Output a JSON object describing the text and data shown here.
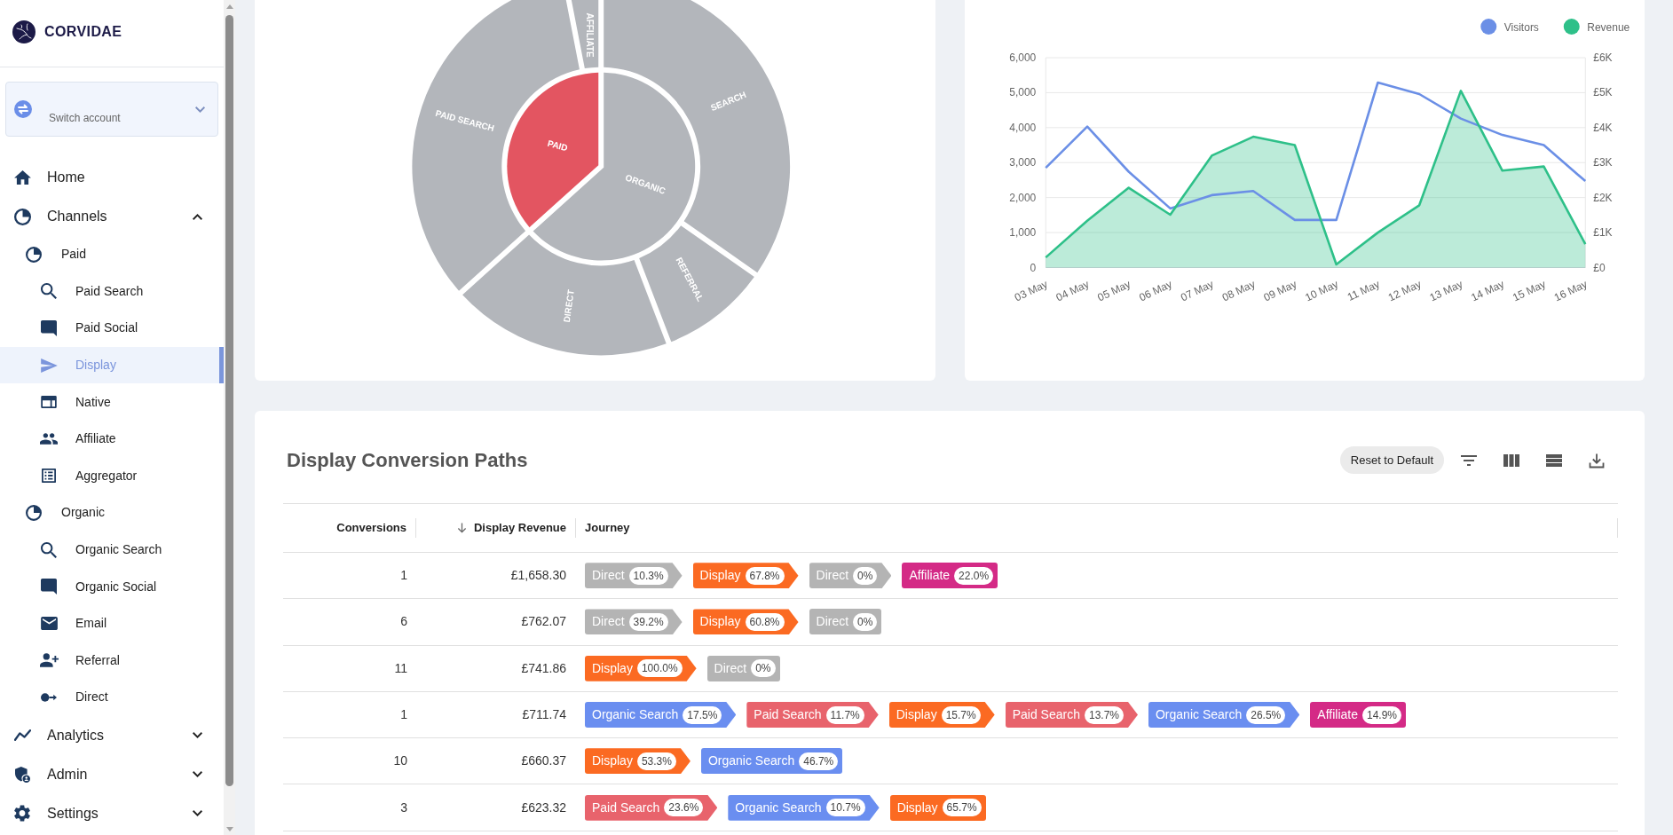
{
  "sidebar": {
    "brand": "CORVIDAE",
    "account": {
      "label": "Switch account",
      "expanded": false
    },
    "nav": [
      {
        "label": "Home",
        "selected": false
      },
      {
        "label": "Channels",
        "selected": false,
        "expanded": true,
        "children": [
          {
            "label": "Paid",
            "selected": false,
            "children": [
              {
                "label": "Paid Search",
                "selected": false
              },
              {
                "label": "Paid Social",
                "selected": false
              },
              {
                "label": "Display",
                "selected": true
              },
              {
                "label": "Native",
                "selected": false
              },
              {
                "label": "Affiliate",
                "selected": false
              },
              {
                "label": "Aggregator",
                "selected": false
              }
            ]
          },
          {
            "label": "Organic",
            "selected": false,
            "children": [
              {
                "label": "Organic Search",
                "selected": false
              },
              {
                "label": "Organic Social",
                "selected": false
              },
              {
                "label": "Email",
                "selected": false
              },
              {
                "label": "Referral",
                "selected": false
              },
              {
                "label": "Direct",
                "selected": false
              }
            ]
          }
        ]
      },
      {
        "label": "Analytics",
        "selected": false,
        "expanded": false
      },
      {
        "label": "Admin",
        "selected": false,
        "expanded": false
      },
      {
        "label": "Settings",
        "selected": false,
        "expanded": false
      }
    ]
  },
  "sunburst": {
    "inner": [
      {
        "label": "ORGANIC",
        "selected": false
      },
      {
        "label": "PAID",
        "selected": true
      }
    ],
    "outer": [
      {
        "label": "SEARCH",
        "selected": false
      },
      {
        "label": "REFERRAL",
        "selected": false
      },
      {
        "label": "DIRECT",
        "selected": false
      },
      {
        "label": "PAID SEARCH",
        "selected": false
      },
      {
        "label": "AFFILIATE",
        "selected": false
      }
    ]
  },
  "trend_chart": {
    "chart_data": {
      "type": "line",
      "categories": [
        "03 May",
        "04 May",
        "05 May",
        "06 May",
        "07 May",
        "08 May",
        "09 May",
        "10 May",
        "11 May",
        "12 May",
        "13 May",
        "14 May",
        "15 May",
        "16 May"
      ],
      "series": [
        {
          "name": "Visitors",
          "color": "#6b8fe6",
          "type": "line",
          "values": [
            2850,
            4030,
            2740,
            1690,
            2070,
            2190,
            1360,
            1360,
            5290,
            4960,
            4260,
            3790,
            3500,
            2470
          ]
        },
        {
          "name": "Revenue",
          "color": "#2ec089",
          "type": "area",
          "values": [
            290,
            1340,
            2280,
            1510,
            3200,
            3740,
            3500,
            90,
            1000,
            1780,
            5050,
            2770,
            2890,
            670
          ]
        }
      ],
      "ylim": [
        0,
        6000
      ],
      "y2lim": [
        0,
        6000
      ],
      "grid": true,
      "legend": "upper right",
      "yticks": [
        {
          "value": 0,
          "label": "0"
        },
        {
          "value": 1000,
          "label": "1,000"
        },
        {
          "value": 2000,
          "label": "2,000"
        },
        {
          "value": 3000,
          "label": "3,000"
        },
        {
          "value": 4000,
          "label": "4,000"
        },
        {
          "value": 5000,
          "label": "5,000"
        },
        {
          "value": 6000,
          "label": "6,000"
        }
      ],
      "y2ticks": [
        {
          "value": 0,
          "label": "£0"
        },
        {
          "value": 1000,
          "label": "£1K"
        },
        {
          "value": 2000,
          "label": "£2K"
        },
        {
          "value": 3000,
          "label": "£3K"
        },
        {
          "value": 4000,
          "label": "£4K"
        },
        {
          "value": 5000,
          "label": "£5K"
        },
        {
          "value": 6000,
          "label": "£6K"
        }
      ]
    }
  },
  "conversion_paths": {
    "title": "Display Conversion Paths",
    "reset_button": "Reset to Default",
    "columns": [
      {
        "label": "Conversions",
        "sorted": false
      },
      {
        "label": "Display Revenue",
        "sorted": true
      },
      {
        "label": "Journey",
        "sorted": false
      }
    ],
    "rows": [
      {
        "conversions": "1",
        "revenue": "£1,658.30",
        "journey": [
          {
            "channel": "Direct",
            "share": "10.3%",
            "color": "#b4b4b4"
          },
          {
            "channel": "Display",
            "share": "67.8%",
            "color": "#fb6a22"
          },
          {
            "channel": "Direct",
            "share": "0%",
            "color": "#b4b4b4"
          },
          {
            "channel": "Affiliate",
            "share": "22.0%",
            "color": "#d42a86"
          }
        ]
      },
      {
        "conversions": "6",
        "revenue": "£762.07",
        "journey": [
          {
            "channel": "Direct",
            "share": "39.2%",
            "color": "#b4b4b4"
          },
          {
            "channel": "Display",
            "share": "60.8%",
            "color": "#fb6a22"
          },
          {
            "channel": "Direct",
            "share": "0%",
            "color": "#b4b4b4"
          }
        ]
      },
      {
        "conversions": "11",
        "revenue": "£741.86",
        "journey": [
          {
            "channel": "Display",
            "share": "100.0%",
            "color": "#fb6a22"
          },
          {
            "channel": "Direct",
            "share": "0%",
            "color": "#b4b4b4"
          }
        ]
      },
      {
        "conversions": "1",
        "revenue": "£711.74",
        "journey": [
          {
            "channel": "Organic Search",
            "share": "17.5%",
            "color": "#6a8ef0"
          },
          {
            "channel": "Paid Search",
            "share": "11.7%",
            "color": "#e8636c"
          },
          {
            "channel": "Display",
            "share": "15.7%",
            "color": "#fb6a22"
          },
          {
            "channel": "Paid Search",
            "share": "13.7%",
            "color": "#e8636c"
          },
          {
            "channel": "Organic Search",
            "share": "26.5%",
            "color": "#6a8ef0"
          },
          {
            "channel": "Affiliate",
            "share": "14.9%",
            "color": "#d42a86"
          }
        ]
      },
      {
        "conversions": "10",
        "revenue": "£660.37",
        "journey": [
          {
            "channel": "Display",
            "share": "53.3%",
            "color": "#fb6a22"
          },
          {
            "channel": "Organic Search",
            "share": "46.7%",
            "color": "#6a8ef0"
          }
        ]
      },
      {
        "conversions": "3",
        "revenue": "£623.32",
        "journey": [
          {
            "channel": "Paid Search",
            "share": "23.6%",
            "color": "#e8636c"
          },
          {
            "channel": "Organic Search",
            "share": "10.7%",
            "color": "#6a8ef0"
          },
          {
            "channel": "Display",
            "share": "65.7%",
            "color": "#fb6a22"
          }
        ]
      }
    ]
  }
}
